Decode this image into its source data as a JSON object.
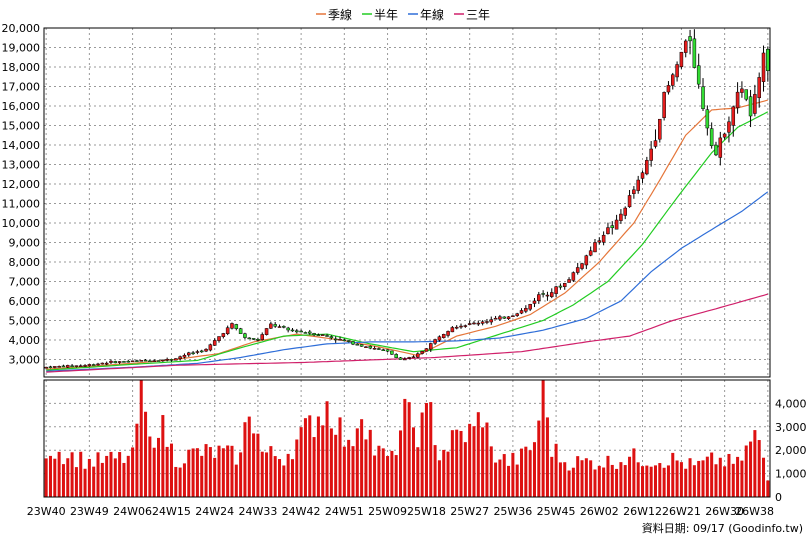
{
  "chart_data": {
    "type": "candlestick-with-volume",
    "legend": [
      {
        "name": "季線",
        "color": "#e5763a"
      },
      {
        "name": "半年",
        "color": "#22cc22"
      },
      {
        "name": "年線",
        "color": "#2f6ed8"
      },
      {
        "name": "三年",
        "color": "#d0206a"
      }
    ],
    "price_axis": {
      "ylim": [
        2100,
        20000
      ],
      "ticks": [
        "20,000",
        "19,000",
        "18,000",
        "17,000",
        "16,000",
        "15,000",
        "14,000",
        "13,000",
        "12,000",
        "11,000",
        "10,000",
        "9,000",
        "8,000",
        "7,000",
        "6,000",
        "5,000",
        "4,000",
        "3,000"
      ],
      "tick_values": [
        20000,
        19000,
        18000,
        17000,
        16000,
        15000,
        14000,
        13000,
        12000,
        11000,
        10000,
        9000,
        8000,
        7000,
        6000,
        5000,
        4000,
        3000
      ]
    },
    "volume_axis": {
      "ylim": [
        0,
        5000
      ],
      "ticks": [
        "4,000",
        "3,000",
        "2,000",
        "1,000",
        "0"
      ],
      "tick_values": [
        4000,
        3000,
        2000,
        1000,
        0
      ]
    },
    "x_labels": [
      "23W40",
      "23W49",
      "24W06",
      "24W15",
      "24W24",
      "24W33",
      "24W42",
      "24W51",
      "25W09",
      "25W18",
      "25W27",
      "25W36",
      "25W45",
      "26W02",
      "26W12",
      "26W21",
      "26W30",
      "26W38"
    ],
    "close_anchors": [
      [
        0,
        2600
      ],
      [
        4,
        2650
      ],
      [
        9,
        2700
      ],
      [
        14,
        2850
      ],
      [
        19,
        2900
      ],
      [
        24,
        2950
      ],
      [
        29,
        3000
      ],
      [
        33,
        3300
      ],
      [
        37,
        3500
      ],
      [
        41,
        4400
      ],
      [
        43,
        4800
      ],
      [
        46,
        4100
      ],
      [
        49,
        4000
      ],
      [
        52,
        4800
      ],
      [
        56,
        4500
      ],
      [
        60,
        4400
      ],
      [
        64,
        4250
      ],
      [
        68,
        4000
      ],
      [
        72,
        3800
      ],
      [
        75,
        3600
      ],
      [
        79,
        3400
      ],
      [
        82,
        3000
      ],
      [
        85,
        3100
      ],
      [
        88,
        3600
      ],
      [
        91,
        4200
      ],
      [
        94,
        4700
      ],
      [
        98,
        4800
      ],
      [
        102,
        5000
      ],
      [
        105,
        5100
      ],
      [
        108,
        5300
      ],
      [
        111,
        5600
      ],
      [
        114,
        6300
      ],
      [
        117,
        6500
      ],
      [
        120,
        6900
      ],
      [
        123,
        7700
      ],
      [
        126,
        8600
      ],
      [
        129,
        9500
      ],
      [
        132,
        10000
      ],
      [
        135,
        11300
      ],
      [
        138,
        12500
      ],
      [
        141,
        14500
      ],
      [
        143,
        16500
      ],
      [
        145,
        17500
      ],
      [
        147,
        18700
      ],
      [
        149,
        19500
      ],
      [
        151,
        17000
      ],
      [
        153,
        15000
      ],
      [
        155,
        13500
      ],
      [
        157,
        14800
      ],
      [
        159,
        16000
      ],
      [
        161,
        17000
      ],
      [
        163,
        15500
      ],
      [
        165,
        17200
      ],
      [
        166,
        19000
      ],
      [
        167,
        18000
      ]
    ],
    "ma_anchors": {
      "季線": [
        [
          0,
          2500
        ],
        [
          20,
          2800
        ],
        [
          30,
          3000
        ],
        [
          40,
          3300
        ],
        [
          48,
          3900
        ],
        [
          58,
          4300
        ],
        [
          68,
          4000
        ],
        [
          78,
          3600
        ],
        [
          86,
          3200
        ],
        [
          95,
          4200
        ],
        [
          104,
          4700
        ],
        [
          112,
          5300
        ],
        [
          120,
          6400
        ],
        [
          128,
          8000
        ],
        [
          136,
          10000
        ],
        [
          142,
          12200
        ],
        [
          148,
          14500
        ],
        [
          154,
          15800
        ],
        [
          160,
          15900
        ],
        [
          167,
          16300
        ]
      ],
      "半年": [
        [
          0,
          2450
        ],
        [
          20,
          2750
        ],
        [
          35,
          2950
        ],
        [
          45,
          3600
        ],
        [
          55,
          4200
        ],
        [
          65,
          4300
        ],
        [
          75,
          3800
        ],
        [
          85,
          3400
        ],
        [
          95,
          3600
        ],
        [
          105,
          4300
        ],
        [
          115,
          5000
        ],
        [
          122,
          5800
        ],
        [
          130,
          7000
        ],
        [
          138,
          8900
        ],
        [
          146,
          11300
        ],
        [
          154,
          13600
        ],
        [
          160,
          14900
        ],
        [
          167,
          15700
        ]
      ],
      "年線": [
        [
          0,
          2400
        ],
        [
          20,
          2600
        ],
        [
          35,
          2800
        ],
        [
          45,
          3100
        ],
        [
          55,
          3500
        ],
        [
          65,
          3800
        ],
        [
          75,
          3900
        ],
        [
          85,
          3900
        ],
        [
          95,
          3950
        ],
        [
          105,
          4100
        ],
        [
          115,
          4500
        ],
        [
          125,
          5100
        ],
        [
          133,
          6000
        ],
        [
          140,
          7500
        ],
        [
          147,
          8700
        ],
        [
          155,
          9800
        ],
        [
          161,
          10600
        ],
        [
          167,
          11600
        ]
      ],
      "三年": [
        [
          0,
          2350
        ],
        [
          30,
          2700
        ],
        [
          60,
          2850
        ],
        [
          90,
          3100
        ],
        [
          110,
          3400
        ],
        [
          125,
          3900
        ],
        [
          135,
          4200
        ],
        [
          145,
          5000
        ],
        [
          155,
          5600
        ],
        [
          167,
          6350
        ]
      ]
    },
    "volume_anchors": [
      [
        0,
        2100
      ],
      [
        10,
        1500
      ],
      [
        20,
        1700
      ],
      [
        22,
        4800
      ],
      [
        24,
        2200
      ],
      [
        26,
        3300
      ],
      [
        30,
        1600
      ],
      [
        35,
        1900
      ],
      [
        40,
        1900
      ],
      [
        45,
        1700
      ],
      [
        47,
        4000
      ],
      [
        50,
        1900
      ],
      [
        55,
        1700
      ],
      [
        60,
        2800
      ],
      [
        63,
        3500
      ],
      [
        65,
        3900
      ],
      [
        67,
        3400
      ],
      [
        70,
        2000
      ],
      [
        73,
        3900
      ],
      [
        76,
        2000
      ],
      [
        80,
        1600
      ],
      [
        83,
        3500
      ],
      [
        86,
        2800
      ],
      [
        89,
        3600
      ],
      [
        91,
        1800
      ],
      [
        95,
        2600
      ],
      [
        99,
        2800
      ],
      [
        101,
        3700
      ],
      [
        103,
        1900
      ],
      [
        107,
        1500
      ],
      [
        110,
        1700
      ],
      [
        113,
        2300
      ],
      [
        115,
        4700
      ],
      [
        117,
        2100
      ],
      [
        120,
        1500
      ],
      [
        124,
        1500
      ],
      [
        130,
        1500
      ],
      [
        135,
        1700
      ],
      [
        140,
        1600
      ],
      [
        145,
        1600
      ],
      [
        150,
        1300
      ],
      [
        155,
        1600
      ],
      [
        160,
        1400
      ],
      [
        164,
        2600
      ],
      [
        166,
        1700
      ],
      [
        167,
        700
      ]
    ],
    "candle_count": 168,
    "source_note": "資料日期: 09/17  (Goodinfo.tw)"
  }
}
